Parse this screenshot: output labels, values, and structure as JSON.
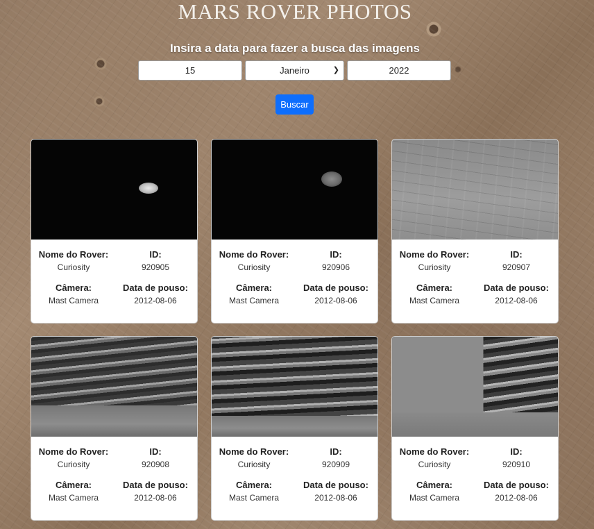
{
  "header": {
    "title": "MARS ROVER PHOTOS",
    "subtitle": "Insira a data para fazer a busca das imagens"
  },
  "search": {
    "day": "15",
    "month": "Janeiro",
    "year": "2022",
    "button_label": "Buscar"
  },
  "labels": {
    "rover": "Nome do Rover:",
    "id": "ID:",
    "camera": "Câmera:",
    "landing": "Data de pouso:"
  },
  "cards": [
    {
      "rover": "Curiosity",
      "id": "920905",
      "camera": "Mast Camera",
      "landing": "2012-08-06"
    },
    {
      "rover": "Curiosity",
      "id": "920906",
      "camera": "Mast Camera",
      "landing": "2012-08-06"
    },
    {
      "rover": "Curiosity",
      "id": "920907",
      "camera": "Mast Camera",
      "landing": "2012-08-06"
    },
    {
      "rover": "Curiosity",
      "id": "920908",
      "camera": "Mast Camera",
      "landing": "2012-08-06"
    },
    {
      "rover": "Curiosity",
      "id": "920909",
      "camera": "Mast Camera",
      "landing": "2012-08-06"
    },
    {
      "rover": "Curiosity",
      "id": "920910",
      "camera": "Mast Camera",
      "landing": "2012-08-06"
    }
  ],
  "colors": {
    "button": "#0d6efd",
    "card_background": "#ffffff"
  }
}
